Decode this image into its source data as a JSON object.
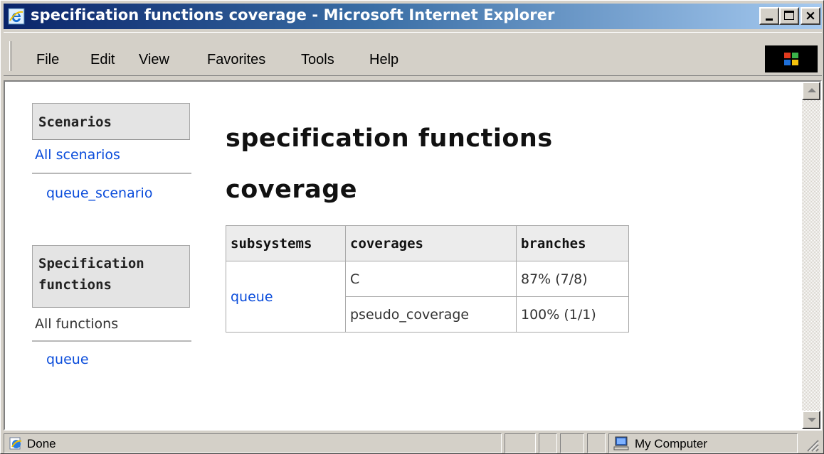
{
  "window": {
    "title": "specification functions coverage - Microsoft Internet Explorer",
    "close_glyph": "×"
  },
  "menu": {
    "items": [
      "File",
      "Edit",
      "View",
      "Favorites",
      "Tools",
      "Help"
    ]
  },
  "sidebar": {
    "scenarios_heading": "Scenarios",
    "all_scenarios": "All scenarios",
    "scenario_link": "queue_scenario",
    "functions_heading": "Specification functions",
    "all_functions": "All functions",
    "function_link": "queue"
  },
  "main": {
    "title": "specification functions coverage",
    "table": {
      "headers": [
        "subsystems",
        "coverages",
        "branches"
      ],
      "subsystem": "queue",
      "rows": [
        {
          "coverage": "C",
          "branches": "87% (7/8)"
        },
        {
          "coverage": "pseudo_coverage",
          "branches": "100% (1/1)"
        }
      ]
    }
  },
  "status": {
    "text": "Done",
    "zone": "My Computer"
  },
  "icons": {
    "title_icon": "ie-icon",
    "throbber": "windows-logo-icon",
    "status_icon": "ie-page-icon",
    "zone_icon": "computer-icon"
  },
  "colors": {
    "title_gradient_start": "#0a246a",
    "title_gradient_end": "#a6caf0",
    "link": "#0a4cdb",
    "chrome": "#d4d0c8"
  }
}
